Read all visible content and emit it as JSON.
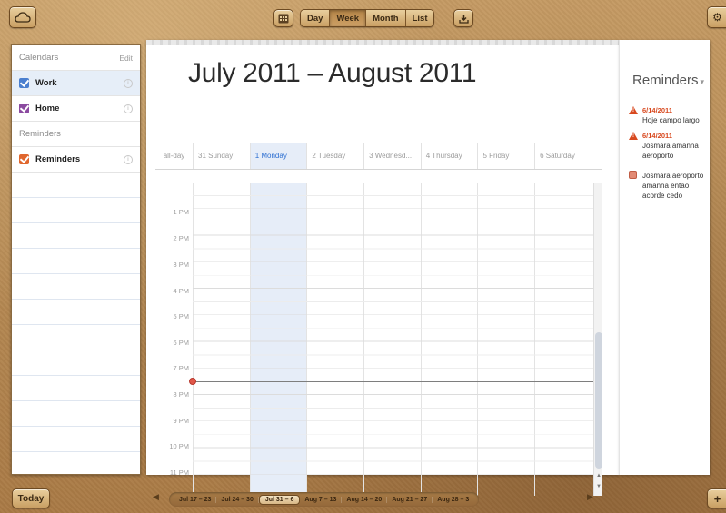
{
  "toolbar": {
    "views": [
      "Day",
      "Week",
      "Month",
      "List"
    ],
    "active_view": "Week"
  },
  "sidebar": {
    "calendars_header": "Calendars",
    "edit_label": "Edit",
    "calendars": [
      {
        "label": "Work",
        "color": "#4a7fcf",
        "selected": true
      },
      {
        "label": "Home",
        "color": "#8b4aa0",
        "selected": false
      }
    ],
    "reminders_header": "Reminders",
    "reminder_lists": [
      {
        "label": "Reminders",
        "color": "#e0672e",
        "selected": false
      }
    ]
  },
  "main": {
    "title": "July 2011 – August 2011",
    "allday_label": "all-day",
    "days": [
      "31 Sunday",
      "1 Monday",
      "2 Tuesday",
      "3 Wednesd...",
      "4 Thursday",
      "5 Friday",
      "6 Saturday"
    ],
    "today_index": 1,
    "hours": [
      "1 PM",
      "2 PM",
      "3 PM",
      "4 PM",
      "5 PM",
      "6 PM",
      "7 PM",
      "8 PM",
      "9 PM",
      "10 PM",
      "11 PM"
    ]
  },
  "reminders_panel": {
    "title": "Reminders",
    "items": [
      {
        "date": "6/14/2011",
        "text": "Hoje campo largo",
        "icon": "overdue-warning-icon"
      },
      {
        "date": "6/14/2011",
        "text": "Josmara amanha aeroporto",
        "icon": "overdue-warning-icon"
      },
      {
        "date": "",
        "text": "Josmara aeroporto amanha então acorde cedo",
        "icon": "reminder-checkbox-icon"
      }
    ]
  },
  "bottom_bar": {
    "today_label": "Today",
    "weeks": [
      "Jul 17 – 23",
      "Jul 24 – 30",
      "Jul 31 – 6",
      "Aug 7 – 13",
      "Aug 14 – 20",
      "Aug 21 – 27",
      "Aug 28 – 3"
    ],
    "current_week_index": 2
  },
  "colors": {
    "accent_today": "#2d6fd1",
    "overdue": "#d8491f",
    "now_indicator": "#e1584a"
  }
}
